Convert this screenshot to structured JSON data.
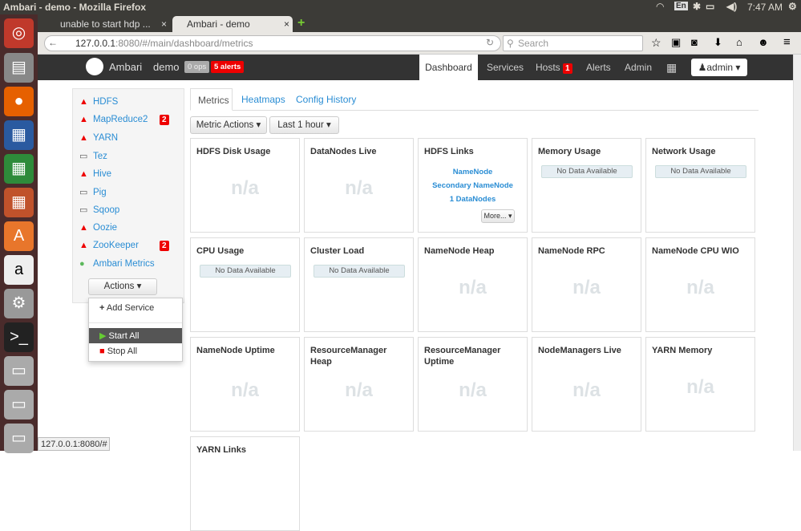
{
  "os": {
    "window_title": "Ambari - demo - Mozilla Firefox",
    "lang": "En",
    "time": "7:47 AM"
  },
  "browser": {
    "tabs": [
      {
        "label": "unable to start hdp ..."
      },
      {
        "label": "Ambari - demo"
      }
    ],
    "url_host": "127.0.0.1",
    "url_rest": ":8080/#/main/dashboard/metrics",
    "search_placeholder": "Search",
    "status_url": "127.0.0.1:8080/#"
  },
  "header": {
    "brand": "Ambari",
    "cluster": "demo",
    "ops": "0 ops",
    "alerts": "5 alerts",
    "nav": [
      {
        "label": "Dashboard"
      },
      {
        "label": "Services"
      },
      {
        "label": "Hosts",
        "badge": "1"
      },
      {
        "label": "Alerts"
      },
      {
        "label": "Admin"
      }
    ],
    "user": "admin"
  },
  "sidebar": {
    "services": [
      {
        "name": "HDFS",
        "status": "warn"
      },
      {
        "name": "MapReduce2",
        "status": "warn",
        "badge": "2"
      },
      {
        "name": "YARN",
        "status": "warn"
      },
      {
        "name": "Tez",
        "status": "client"
      },
      {
        "name": "Hive",
        "status": "warn"
      },
      {
        "name": "Pig",
        "status": "client"
      },
      {
        "name": "Sqoop",
        "status": "client"
      },
      {
        "name": "Oozie",
        "status": "warn"
      },
      {
        "name": "ZooKeeper",
        "status": "warn",
        "badge": "2"
      },
      {
        "name": "Ambari Metrics",
        "status": "ok"
      }
    ],
    "actions_label": "Actions",
    "menu": {
      "add": "Add Service",
      "start": "Start All",
      "stop": "Stop All"
    }
  },
  "main": {
    "tabs": [
      {
        "label": "Metrics"
      },
      {
        "label": "Heatmaps"
      },
      {
        "label": "Config History"
      }
    ],
    "metric_actions": "Metric Actions",
    "time_range": "Last 1 hour",
    "na": "n/a",
    "no_data": "No Data Available",
    "hdfs_links": {
      "namenode": "NameNode",
      "secondary": "Secondary NameNode",
      "datanodes": "1 DataNodes",
      "more": "More..."
    },
    "cards": [
      "HDFS Disk Usage",
      "DataNodes Live",
      "HDFS Links",
      "Memory Usage",
      "Network Usage",
      "CPU Usage",
      "Cluster Load",
      "NameNode Heap",
      "NameNode RPC",
      "NameNode CPU WIO",
      "NameNode Uptime",
      "ResourceManager Heap",
      "ResourceManager Uptime",
      "NodeManagers Live",
      "YARN Memory",
      "YARN Links"
    ]
  }
}
